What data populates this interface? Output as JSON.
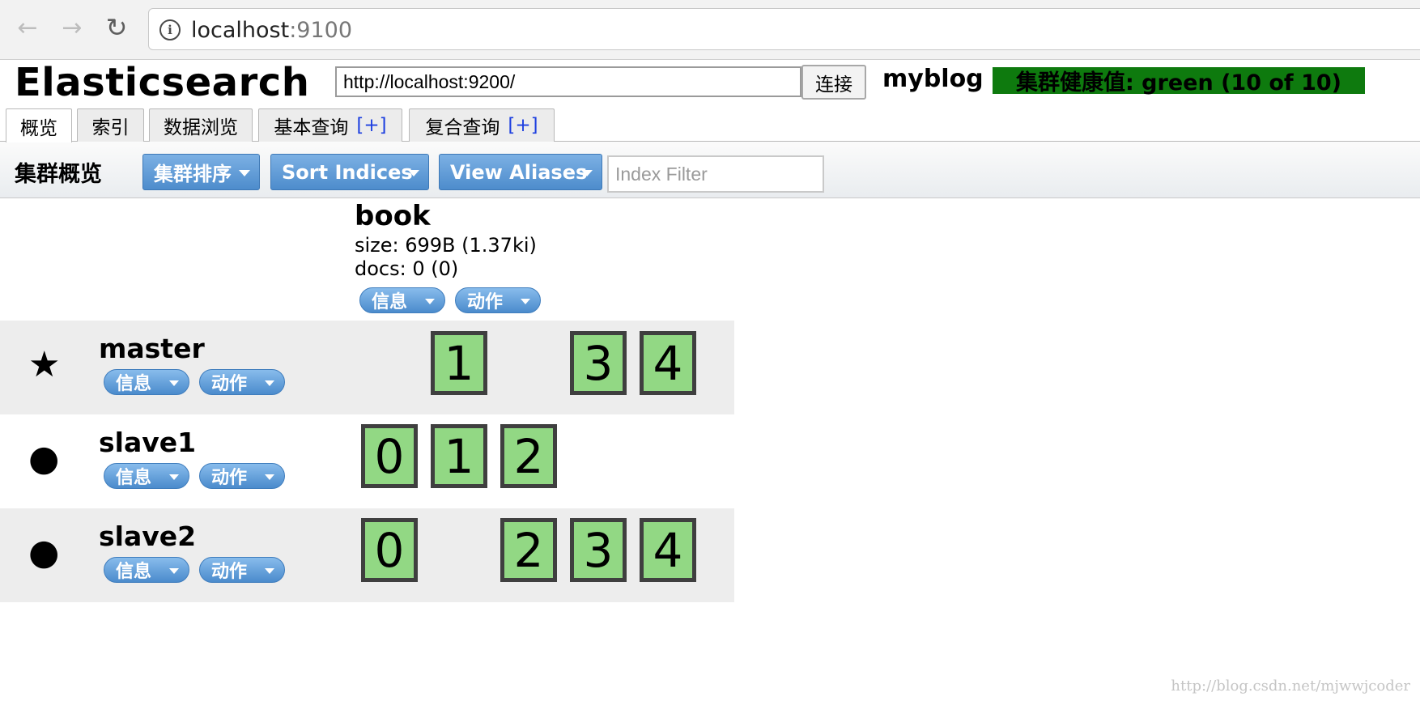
{
  "browser": {
    "url_host": "localhost",
    "url_port": ":9100",
    "back_icon": "←",
    "forward_icon": "→",
    "reload_icon": "↻",
    "info_icon": "i"
  },
  "header": {
    "app_title": "Elasticsearch",
    "connect_url": "http://localhost:9200/",
    "connect_label": "连接",
    "cluster_name": "myblog",
    "health": "集群健康值: green (10 of 10)",
    "health_color": "#0e7a0e"
  },
  "tabs": [
    {
      "label": "概览",
      "plus": ""
    },
    {
      "label": "索引",
      "plus": ""
    },
    {
      "label": "数据浏览",
      "plus": ""
    },
    {
      "label": "基本查询",
      "plus": "[+]"
    },
    {
      "label": "复合查询",
      "plus": "[+]"
    }
  ],
  "toolbar": {
    "title": "集群概览",
    "sort_cluster": "集群排序",
    "sort_indices": "Sort Indices",
    "view_aliases": "View Aliases",
    "filter_placeholder": "Index Filter"
  },
  "index": {
    "name": "book",
    "size": "size: 699B (1.37ki)",
    "docs": "docs: 0 (0)",
    "info_label": "信息",
    "action_label": "动作"
  },
  "nodes": [
    {
      "name": "master",
      "icon": "★",
      "info_label": "信息",
      "action_label": "动作",
      "shards": [
        "1",
        "3",
        "4"
      ]
    },
    {
      "name": "slave1",
      "icon": "●",
      "info_label": "信息",
      "action_label": "动作",
      "shards": [
        "0",
        "1",
        "2"
      ]
    },
    {
      "name": "slave2",
      "icon": "●",
      "info_label": "信息",
      "action_label": "动作",
      "shards": [
        "0",
        "2",
        "3",
        "4"
      ]
    }
  ],
  "shard_color": "#92d884",
  "accent_color": "#4d8ccc",
  "watermark": "http://blog.csdn.net/mjwwjcoder"
}
